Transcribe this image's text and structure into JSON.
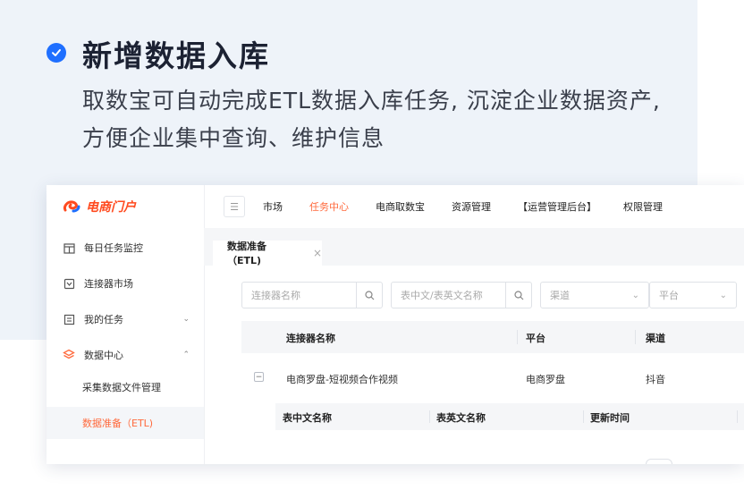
{
  "feature": {
    "title": "新增数据入库",
    "description": "取数宝可自动完成ETL数据入库任务, 沉淀企业数据资产, 方便企业集中查询、维护信息"
  },
  "app": {
    "logo": "电商门户",
    "topnav": [
      "市场",
      "任务中心",
      "电商取数宝",
      "资源管理",
      "【运营管理后台】",
      "权限管理"
    ],
    "active_nav": "任务中心",
    "sidebar": {
      "items": [
        {
          "label": "每日任务监控",
          "icon": "calendar-icon"
        },
        {
          "label": "连接器市场",
          "icon": "connector-icon"
        },
        {
          "label": "我的任务",
          "icon": "list-icon"
        },
        {
          "label": "数据中心",
          "icon": "layers-icon"
        }
      ],
      "subitems": [
        "采集数据文件管理",
        "数据准备（ETL)"
      ]
    },
    "tab": {
      "label": "数据准备（ETL)",
      "close": "×"
    },
    "filters": {
      "connector_placeholder": "连接器名称",
      "table_placeholder": "表中文/表英文名称",
      "channel_placeholder": "渠道",
      "platform_placeholder": "平台"
    },
    "table": {
      "headers": [
        "连接器名称",
        "平台",
        "渠道"
      ],
      "rows": [
        {
          "connector": "电商罗盘-短视频合作视频",
          "platform": "电商罗盘",
          "channel": "抖音"
        }
      ],
      "expand_symbol": "−"
    },
    "subtable": {
      "headers": [
        "表中文名称",
        "表英文名称",
        "更新时间"
      ]
    }
  },
  "colors": {
    "accent": "#ff6a3d",
    "check": "#1f6fff",
    "logo": "#ff4a1f"
  }
}
